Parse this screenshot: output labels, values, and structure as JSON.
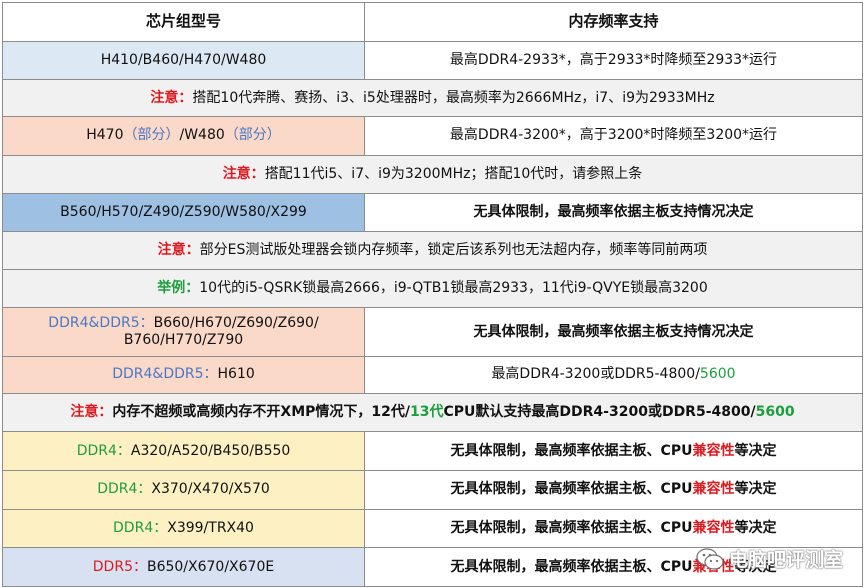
{
  "header": {
    "chipset": "芯片组型号",
    "memory_support": "内存频率支持"
  },
  "rows": [
    {
      "chipset": "H410/B460/H470/W480",
      "support": "最高DDR4-2933*，高于2933*时降频至2933*运行"
    },
    {
      "note_prefix": "注意：",
      "note_text": "搭配10代奔腾、赛扬、i3、i5处理器时，最高频率为2666MHz，i7、i9为2933MHz"
    },
    {
      "chipset_a": "H470",
      "chipset_b": "（部分）",
      "chipset_c": "/W480",
      "chipset_d": "（部分）",
      "support": "最高DDR4-3200*，高于3200*时降频至3200*运行"
    },
    {
      "note_prefix": "注意：",
      "note_text": "搭配11代i5、i7、i9为3200MHz；搭配10代时，请参照上条"
    },
    {
      "chipset": "B560/H570/Z490/Z590/W580/X299",
      "support": "无具体限制，最高频率依据主板支持情况决定"
    },
    {
      "note_prefix": "注意：",
      "note_text": "部分ES测试版处理器会锁内存频率，锁定后该系列也无法超内存，频率等同前两项"
    },
    {
      "note_prefix": "举例：",
      "note_text": "10代的i5-QSRK锁最高2666，i9-QTB1锁最高2933，11代i9-QVYE锁最高3200"
    },
    {
      "chipset_prefix": "DDR4&DDR5：",
      "chipset_line1": "B660/H670/Z690/Z690/",
      "chipset_line2": "B760/H770/Z790",
      "support": "无具体限制，最高频率依据主板支持情况决定"
    },
    {
      "chipset_prefix": "DDR4&DDR5：",
      "chipset": "H610",
      "support_a": "最高DDR4-3200或DDR5-4800/",
      "support_b": "5600"
    },
    {
      "note_prefix": "注意：",
      "note_a": "内存不超频或高频内存不开XMP情况下，12代/",
      "note_b": "13代",
      "note_c": "CPU默认支持最高DDR4-3200或DDR5-4800/",
      "note_d": "5600"
    },
    {
      "chipset_prefix": "DDR4：",
      "chipset": "A320/A520/B450/B550",
      "support_a": "无具体限制，最高频率依据主板、CPU",
      "support_b": "兼容性",
      "support_c": "等决定"
    },
    {
      "chipset_prefix": "DDR4：",
      "chipset": "X370/X470/X570",
      "support_a": "无具体限制，最高频率依据主板、CPU",
      "support_b": "兼容性",
      "support_c": "等决定"
    },
    {
      "chipset_prefix": "DDR4：",
      "chipset": "X399/TRX40",
      "support_a": "无具体限制，最高频率依据主板、CPU",
      "support_b": "兼容性",
      "support_c": "等决定"
    },
    {
      "chipset_prefix": "DDR5：",
      "chipset": "B650/X670/X670E",
      "support_a": "无具体限制，最高频率依据主板、CPU",
      "support_b": "兼容性",
      "support_c": "等决定"
    }
  ],
  "watermark": {
    "text": "电脑吧评测室",
    "icon": "wechat-icon"
  },
  "colors": {
    "light_blue_row": "#dde8f5",
    "salmon_row": "#fbd9c9",
    "steel_blue_row": "#9dc0e3",
    "gray_note_row": "#f1f1f1",
    "yellow_row": "#fdf0c2",
    "lavender_row": "#d7e1f2",
    "red_text": "#e0191f",
    "blue_text": "#4a78c4",
    "green_text": "#1e9e3c"
  }
}
